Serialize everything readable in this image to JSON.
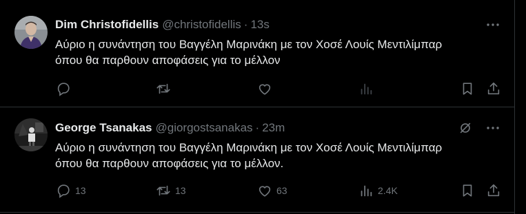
{
  "tweets": [
    {
      "name": "Dim Christofidellis",
      "handle": "@christofidellis",
      "separator": "·",
      "time": "13s",
      "text_line1": "Αύριο η συνάντηση του Βαγγέλη Μαρινάκη με τον Χοσέ Λουίς Μεντιλίμπαρ",
      "text_line2": "όπου θα παρθουν αποφάσεις για το μέλλον",
      "counts": {
        "reply": "",
        "retweet": "",
        "like": "",
        "views": ""
      },
      "icons": [
        "reply-icon",
        "retweet-icon",
        "like-icon",
        "views-icon",
        "bookmark-icon",
        "share-icon",
        "more-icon"
      ]
    },
    {
      "name": "George Tsanakas",
      "handle": "@giorgostsanakas",
      "separator": "·",
      "time": "23m",
      "text_line1": "Αύριο η συνάντηση του Βαγγέλη Μαρινάκη με τον Χοσέ Λουίς Μεντιλίμπαρ",
      "text_line2": "όπου θα παρθουν αποφάσεις για το μέλλον.",
      "counts": {
        "reply": "13",
        "retweet": "13",
        "like": "63",
        "views": "2.4K"
      },
      "icons": [
        "reply-icon",
        "retweet-icon",
        "like-icon",
        "views-icon",
        "bookmark-icon",
        "share-icon",
        "more-icon",
        "grok-icon"
      ]
    }
  ],
  "colors": {
    "background": "#000000",
    "text": "#e7e9ea",
    "secondary": "#71767b",
    "border": "#2f3336"
  }
}
